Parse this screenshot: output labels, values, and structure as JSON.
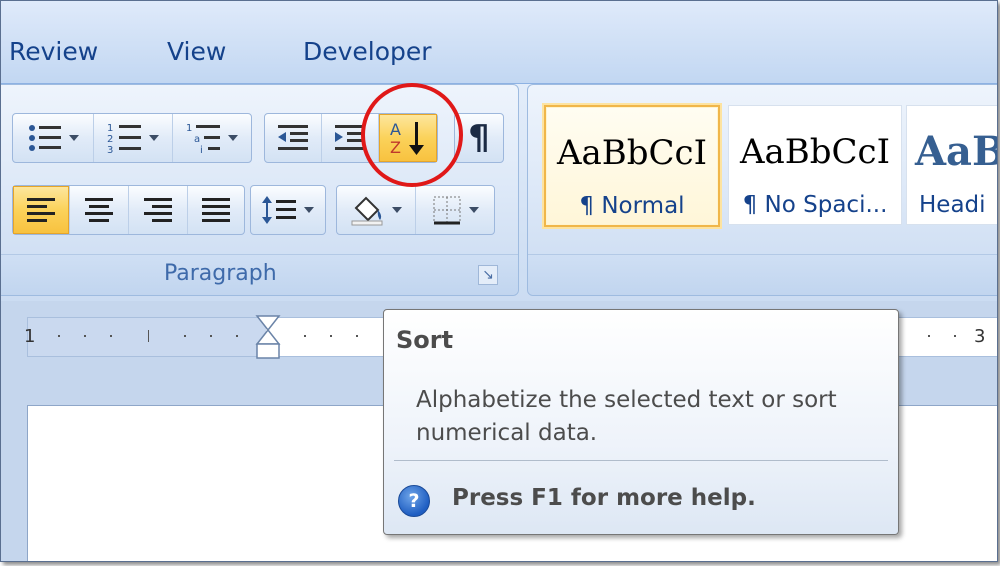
{
  "tabs": [
    "Review",
    "View",
    "Developer"
  ],
  "paragraph_group": {
    "label": "Paragraph",
    "launcher_icon": "dialog-launcher-icon"
  },
  "pilcrow": "¶",
  "styles": [
    {
      "sample": "AaBbCcI",
      "name": "¶ Normal",
      "selected": true
    },
    {
      "sample": "AaBbCcI",
      "name": "¶ No Spaci...",
      "selected": false
    },
    {
      "sample": "AaB",
      "name": "Headi",
      "selected": false
    }
  ],
  "ruler": {
    "left_number": "1",
    "right_number": "3"
  },
  "tooltip": {
    "title": "Sort",
    "body": "Alphabetize the selected text or sort numerical data.",
    "help_icon": "?",
    "help_text": "Press F1 for more help."
  },
  "annotation_color": "#e01818"
}
